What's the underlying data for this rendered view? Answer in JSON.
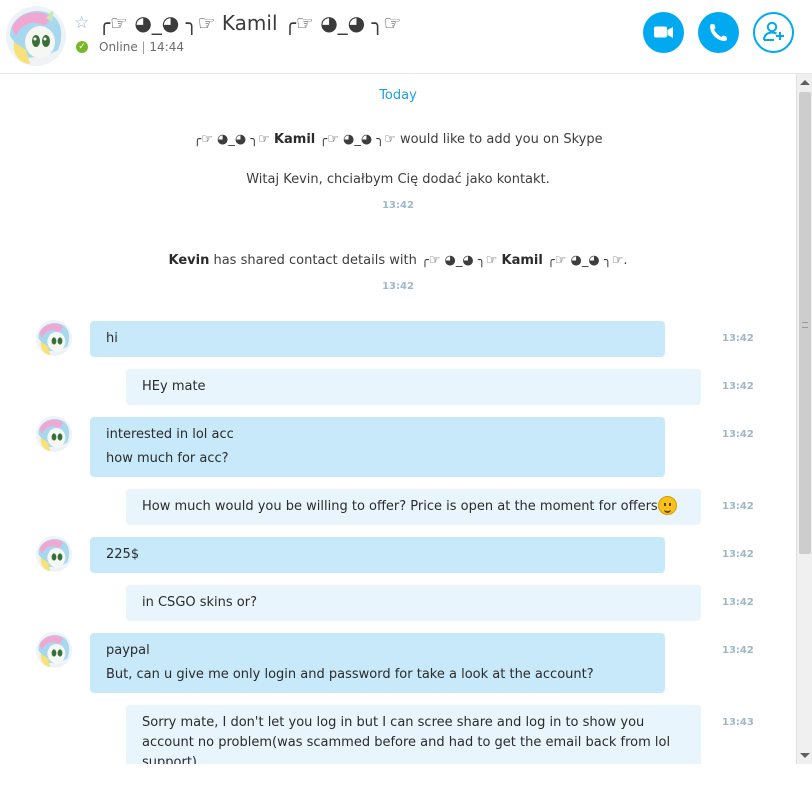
{
  "header": {
    "contact_name": "╭☞ ◕_◕ ╮☞ Kamil ╭☞ ◕_◕ ╮☞",
    "status": "Online",
    "separator": "|",
    "last_seen": "14:44",
    "favorite_icon": "star-outline-icon",
    "buttons": [
      {
        "name": "video-call-button",
        "icon": "video-camera-icon"
      },
      {
        "name": "audio-call-button",
        "icon": "phone-icon"
      },
      {
        "name": "add-contact-button",
        "icon": "add-person-icon"
      }
    ],
    "accent_color": "#00a9f0",
    "online_color": "#7ab829"
  },
  "conversation": {
    "day_label": "Today",
    "system_events": [
      {
        "prefix": "╭☞ ◕_◕ ╮☞ ",
        "bold": "Kamil",
        "middle": " ╭☞ ◕_◕ ╮☞ would like to add you on Skype",
        "note": "Witaj Kevin, chciałbym Cię dodać jako kontakt.",
        "time": "13:42"
      },
      {
        "bold1": "Kevin",
        "middle1": " has shared contact details with ╭☞ ◕_◕ ╮☞ ",
        "bold2": "Kamil",
        "suffix": " ╭☞ ◕_◕ ╮☞.",
        "time": "13:42"
      }
    ],
    "messages": [
      {
        "direction": "in",
        "lines": [
          "hi"
        ],
        "time": "13:42"
      },
      {
        "direction": "out",
        "lines": [
          "HEy mate"
        ],
        "time": "13:42"
      },
      {
        "direction": "in",
        "lines": [
          "interested in lol acc",
          "how much for acc?"
        ],
        "time": "13:42"
      },
      {
        "direction": "out",
        "lines": [
          "How much would you be willing to offer? Price is open at the moment for offers"
        ],
        "emoji": "smile-emoji-icon",
        "time": "13:42"
      },
      {
        "direction": "in",
        "lines": [
          "225$"
        ],
        "time": "13:42"
      },
      {
        "direction": "out",
        "lines": [
          "in CSGO skins or?"
        ],
        "time": "13:42"
      },
      {
        "direction": "in",
        "lines": [
          "paypal",
          "But, can u give me only login and password for take a look at the account?"
        ],
        "time": "13:42"
      },
      {
        "direction": "out",
        "lines": [
          "Sorry mate, I don't let you log in but I can scree share and log in to show you account no problem(was scammed before and had to get the email back from lol support)"
        ],
        "time": "13:43"
      }
    ],
    "bubble_in_color": "#c7e9f9",
    "bubble_out_color": "#e8f5fc"
  }
}
